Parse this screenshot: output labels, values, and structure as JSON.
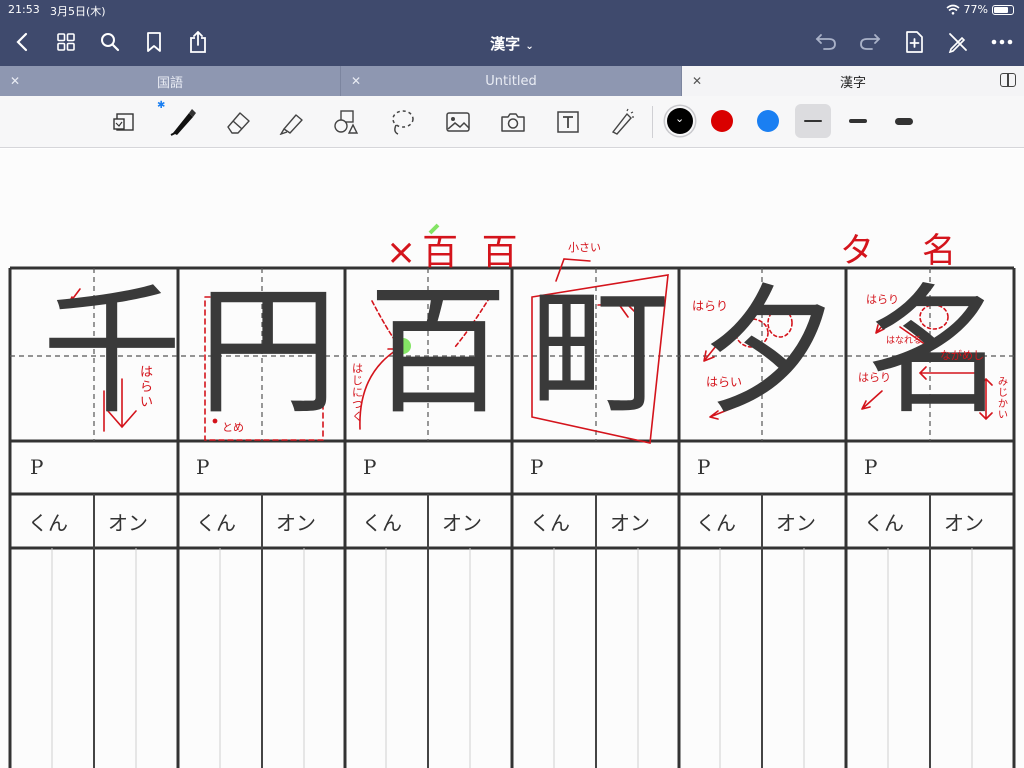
{
  "status": {
    "time": "21:53",
    "date": "3月5日(木)",
    "battery": "77%",
    "battery_level": 0.77
  },
  "nav": {
    "title": "漢字"
  },
  "tabs": [
    {
      "label": "国語"
    },
    {
      "label": "Untitled"
    },
    {
      "label": "漢字"
    }
  ],
  "toolbar": {
    "colors": [
      "#000000",
      "#d90000",
      "#1a7ff2"
    ],
    "selected_color": "#000000",
    "stroke_widths": [
      "thin",
      "medium",
      "thick"
    ],
    "selected_stroke": "thin"
  },
  "worksheet": {
    "cell_label": "P",
    "kun_label": "くん",
    "on_label": "オン",
    "kanji": [
      "千",
      "円",
      "百",
      "町",
      "夕",
      "名"
    ]
  },
  "annotations": {
    "top_row": "×百 百",
    "top_right_1": "タ",
    "top_right_2": "名",
    "c1_note": "はらい",
    "c2_note": "とめ",
    "c3_note": "はじにつく",
    "c4_note": "小さい",
    "c5_note_1": "はらり",
    "c5_note_2": "はらい",
    "c6_note_1": "はらり",
    "c6_note_2": "はなれる",
    "c6_note_3": "ながめし",
    "c6_note_4": "はらり",
    "c6_note_5": "みじかい"
  }
}
